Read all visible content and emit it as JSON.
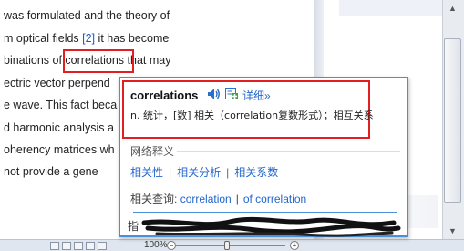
{
  "document": {
    "lines": [
      "was formulated and the theory of",
      "m optical fields ",
      "binations of ",
      "ectric vector perpend",
      "e wave. This fact beca",
      "d harmonic analysis a",
      "oherency matrices wh",
      " not provide a gene"
    ],
    "line2_ref": "[2]",
    "line2_tail": " it has become",
    "line3_word": "correlations",
    "line3_tail": " that may"
  },
  "popup": {
    "word": "correlations",
    "detail_label": "详细»",
    "definition": "n. 统计，[数] 相关（correlation复数形式）；相互关系",
    "net_title": "网络释义",
    "net_items": [
      "相关性",
      "相关分析",
      "相关系数"
    ],
    "query_label": "相关查询:",
    "query_links": [
      "correlation",
      "of correlation"
    ],
    "obscured_prefix": "指"
  },
  "statusbar": {
    "zoom": "100%"
  },
  "colors": {
    "highlight_border": "#e02020",
    "popup_border": "#4a90d9",
    "link": "#2266cc"
  },
  "icons": {
    "speaker": "speaker-icon",
    "add": "add-to-wordbook-icon"
  }
}
